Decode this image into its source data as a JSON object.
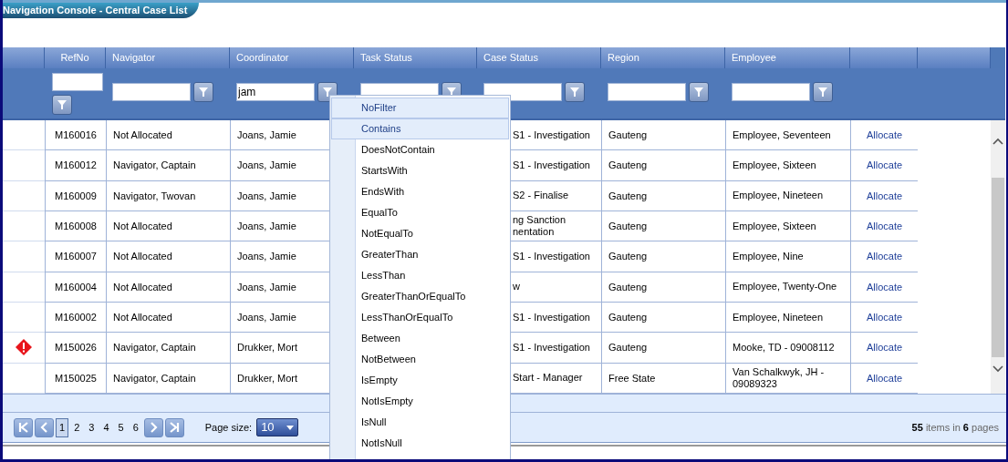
{
  "window": {
    "title": "Navigation Console - Central Case List"
  },
  "columns": [
    {
      "label": "RefNo"
    },
    {
      "label": "Navigator"
    },
    {
      "label": "Coordinator",
      "filter_value": "jam"
    },
    {
      "label": "Task Status"
    },
    {
      "label": "Case Status"
    },
    {
      "label": "Region"
    },
    {
      "label": "Employee"
    }
  ],
  "rows": [
    {
      "alert": false,
      "ref": "M160016",
      "navigator": "Not Allocated",
      "coordinator": "Joans, Jamie",
      "case_status": "S1 - Investigation",
      "region": "Gauteng",
      "employee": "Employee, Seventeen",
      "action": "Allocate"
    },
    {
      "alert": false,
      "ref": "M160012",
      "navigator": "Navigator, Captain",
      "coordinator": "Joans, Jamie",
      "case_status": "S1 - Investigation",
      "region": "Gauteng",
      "employee": "Employee, Sixteen",
      "action": "Allocate"
    },
    {
      "alert": false,
      "ref": "M160009",
      "navigator": "Navigator, Twovan",
      "coordinator": "Joans, Jamie",
      "case_status": "S2 - Finalise",
      "region": "Gauteng",
      "employee": "Employee, Nineteen",
      "action": "Allocate"
    },
    {
      "alert": false,
      "ref": "M160008",
      "navigator": "Not Allocated",
      "coordinator": "Joans, Jamie",
      "case_status": "ng Sanction\nnentation",
      "region": "Gauteng",
      "employee": "Employee, Sixteen",
      "action": "Allocate"
    },
    {
      "alert": false,
      "ref": "M160007",
      "navigator": "Not Allocated",
      "coordinator": "Joans, Jamie",
      "case_status": "S1 - Investigation",
      "region": "Gauteng",
      "employee": "Employee, Nine",
      "action": "Allocate"
    },
    {
      "alert": false,
      "ref": "M160004",
      "navigator": "Not Allocated",
      "coordinator": "Joans, Jamie",
      "case_status": "w",
      "region": "Gauteng",
      "employee": "Employee, Twenty-One",
      "action": "Allocate"
    },
    {
      "alert": false,
      "ref": "M160002",
      "navigator": "Not Allocated",
      "coordinator": "Joans, Jamie",
      "case_status": "S1 - Investigation",
      "region": "Gauteng",
      "employee": "Employee, Nineteen",
      "action": "Allocate"
    },
    {
      "alert": true,
      "ref": "M150026",
      "navigator": "Navigator, Captain",
      "coordinator": "Drukker, Mort",
      "case_status": "S1 - Investigation",
      "region": "Gauteng",
      "employee": "Mooke, TD - 09008112",
      "action": "Allocate"
    },
    {
      "alert": false,
      "ref": "M150025",
      "navigator": "Navigator, Captain",
      "coordinator": "Drukker, Mort",
      "case_status": "Start - Manager",
      "region": "Free State",
      "employee": "Van Schalkwyk, JH - 09089323",
      "action": "Allocate"
    }
  ],
  "filter_menu": [
    {
      "label": "NoFilter",
      "highlighted": true
    },
    {
      "label": "Contains",
      "highlighted": true
    },
    {
      "label": "DoesNotContain",
      "highlighted": false
    },
    {
      "label": "StartsWith",
      "highlighted": false
    },
    {
      "label": "EndsWith",
      "highlighted": false
    },
    {
      "label": "EqualTo",
      "highlighted": false
    },
    {
      "label": "NotEqualTo",
      "highlighted": false
    },
    {
      "label": "GreaterThan",
      "highlighted": false
    },
    {
      "label": "LessThan",
      "highlighted": false
    },
    {
      "label": "GreaterThanOrEqualTo",
      "highlighted": false
    },
    {
      "label": "LessThanOrEqualTo",
      "highlighted": false
    },
    {
      "label": "Between",
      "highlighted": false
    },
    {
      "label": "NotBetween",
      "highlighted": false
    },
    {
      "label": "IsEmpty",
      "highlighted": false
    },
    {
      "label": "NotIsEmpty",
      "highlighted": false
    },
    {
      "label": "IsNull",
      "highlighted": false
    },
    {
      "label": "NotIsNull",
      "highlighted": false
    }
  ],
  "pager": {
    "pages": [
      {
        "label": "1",
        "selected": true
      },
      {
        "label": "2",
        "selected": false
      },
      {
        "label": "3",
        "selected": false
      },
      {
        "label": "4",
        "selected": false
      },
      {
        "label": "5",
        "selected": false
      },
      {
        "label": "6",
        "selected": false
      }
    ],
    "page_size_label": "Page size:",
    "page_size": "10",
    "summary": "**55** items in **6** pages"
  }
}
